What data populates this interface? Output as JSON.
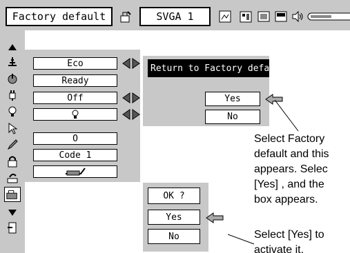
{
  "menubar": {
    "title": "Factory default",
    "input_source": "SVGA 1",
    "icons": [
      "adjust-icon",
      "image-icon",
      "pc-adjust-icon",
      "screen-icon",
      "speaker-icon",
      "slider-icon"
    ]
  },
  "sidebar": {
    "icons": [
      "up-arrow-icon",
      "lamp-mode-icon",
      "standby-icon",
      "power-management-icon",
      "lamp-icon",
      "pointer-icon",
      "pen-icon",
      "lock-icon",
      "counter-reset-icon",
      "factory-default-icon",
      "down-arrow-icon",
      "exit-icon"
    ]
  },
  "settings": {
    "rows": [
      {
        "value": "Eco"
      },
      {
        "value": "Ready"
      },
      {
        "value": "Off"
      },
      {
        "value": ""
      },
      {
        "value": "O"
      },
      {
        "value": "Code 1"
      },
      {
        "value": ""
      }
    ]
  },
  "dialog_factory": {
    "title": "Return to Factory default ?",
    "yes": "Yes",
    "no": "No"
  },
  "dialog_ok": {
    "title": "OK ?",
    "yes": "Yes",
    "no": "No"
  },
  "callouts": {
    "first": [
      "Select Factory",
      "default and this",
      "appears.  Selec",
      "[Yes] , and the",
      "box appears."
    ],
    "second": [
      "Select [Yes] to",
      "activate it."
    ]
  },
  "colors": {
    "panel": "#c8c8c8",
    "title_bar": "#000000",
    "button": "#ffffff"
  }
}
